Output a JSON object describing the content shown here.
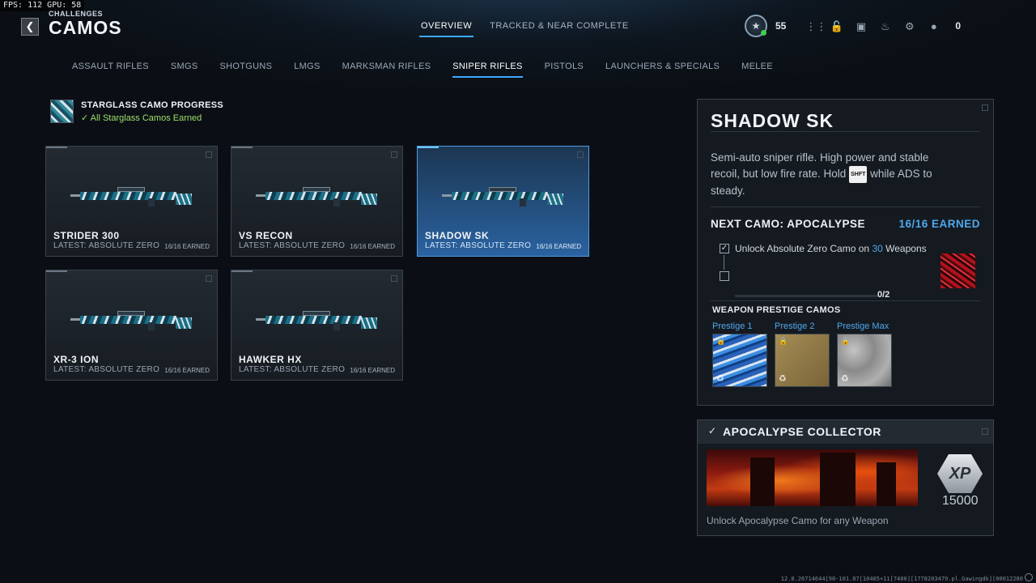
{
  "debug": {
    "fps_text": "FPS: 112 GPU: 58"
  },
  "header": {
    "breadcrumb": "CHALLENGES",
    "title": "CAMOS",
    "tabs": [
      {
        "label": "OVERVIEW",
        "active": true
      },
      {
        "label": "TRACKED & NEAR COMPLETE",
        "active": false
      }
    ],
    "level": "55",
    "party_count": "0",
    "icons": [
      "grid-menu-icon",
      "lock-icon",
      "camera-icon",
      "bell-icon",
      "gear-icon",
      "party-icon"
    ]
  },
  "categories": [
    {
      "label": "ASSAULT RIFLES",
      "active": false
    },
    {
      "label": "SMGS",
      "active": false
    },
    {
      "label": "SHOTGUNS",
      "active": false
    },
    {
      "label": "LMGS",
      "active": false
    },
    {
      "label": "MARKSMAN RIFLES",
      "active": false
    },
    {
      "label": "SNIPER RIFLES",
      "active": true
    },
    {
      "label": "PISTOLS",
      "active": false
    },
    {
      "label": "LAUNCHERS & SPECIALS",
      "active": false
    },
    {
      "label": "MELEE",
      "active": false
    }
  ],
  "progress": {
    "title": "STARGLASS CAMO PROGRESS",
    "status": "All Starglass Camos Earned",
    "status_icon": "checkmark-icon"
  },
  "weapons": [
    {
      "name": "STRIDER 300",
      "latest": "LATEST: ABSOLUTE ZERO",
      "count": "16/16 EARNED",
      "selected": false
    },
    {
      "name": "VS RECON",
      "latest": "LATEST: ABSOLUTE ZERO",
      "count": "16/16 EARNED",
      "selected": false
    },
    {
      "name": "SHADOW SK",
      "latest": "LATEST: ABSOLUTE ZERO",
      "count": "16/16 EARNED",
      "selected": true
    },
    {
      "name": "XR-3 ION",
      "latest": "LATEST: ABSOLUTE ZERO",
      "count": "16/16 EARNED",
      "selected": false
    },
    {
      "name": "HAWKER HX",
      "latest": "LATEST: ABSOLUTE ZERO",
      "count": "16/16 EARNED",
      "selected": false
    }
  ],
  "detail": {
    "title": "SHADOW SK",
    "desc_before": "Semi-auto sniper rifle. High power and stable recoil, but low fire rate. Hold",
    "key": "SHFT",
    "desc_after": "while ADS to steady.",
    "next_camo": "NEXT CAMO: APOCALYPSE",
    "earned": "16/16 EARNED",
    "req_before": "Unlock Absolute Zero Camo on",
    "req_count": "30",
    "req_after": "Weapons",
    "sub_count": "0/2",
    "sub_progress": 0,
    "prestige_heading": "WEAPON PRESTIGE CAMOS",
    "prestige": [
      {
        "label": "Prestige 1"
      },
      {
        "label": "Prestige 2"
      },
      {
        "label": "Prestige Max"
      }
    ]
  },
  "reward": {
    "title": "APOCALYPSE COLLECTOR",
    "xp_badge": "XP",
    "xp_value": "15000",
    "description": "Unlock Apocalypse Camo for any Weapon"
  },
  "footer": {
    "build": "12.8.26714644[90-101.87[10405+11[7400][1778203479.pl.Gawingdk][00012280"
  },
  "colors": {
    "accent": "#3ea8ff",
    "earned": "#4ea8ee",
    "success": "#9ee06a"
  }
}
